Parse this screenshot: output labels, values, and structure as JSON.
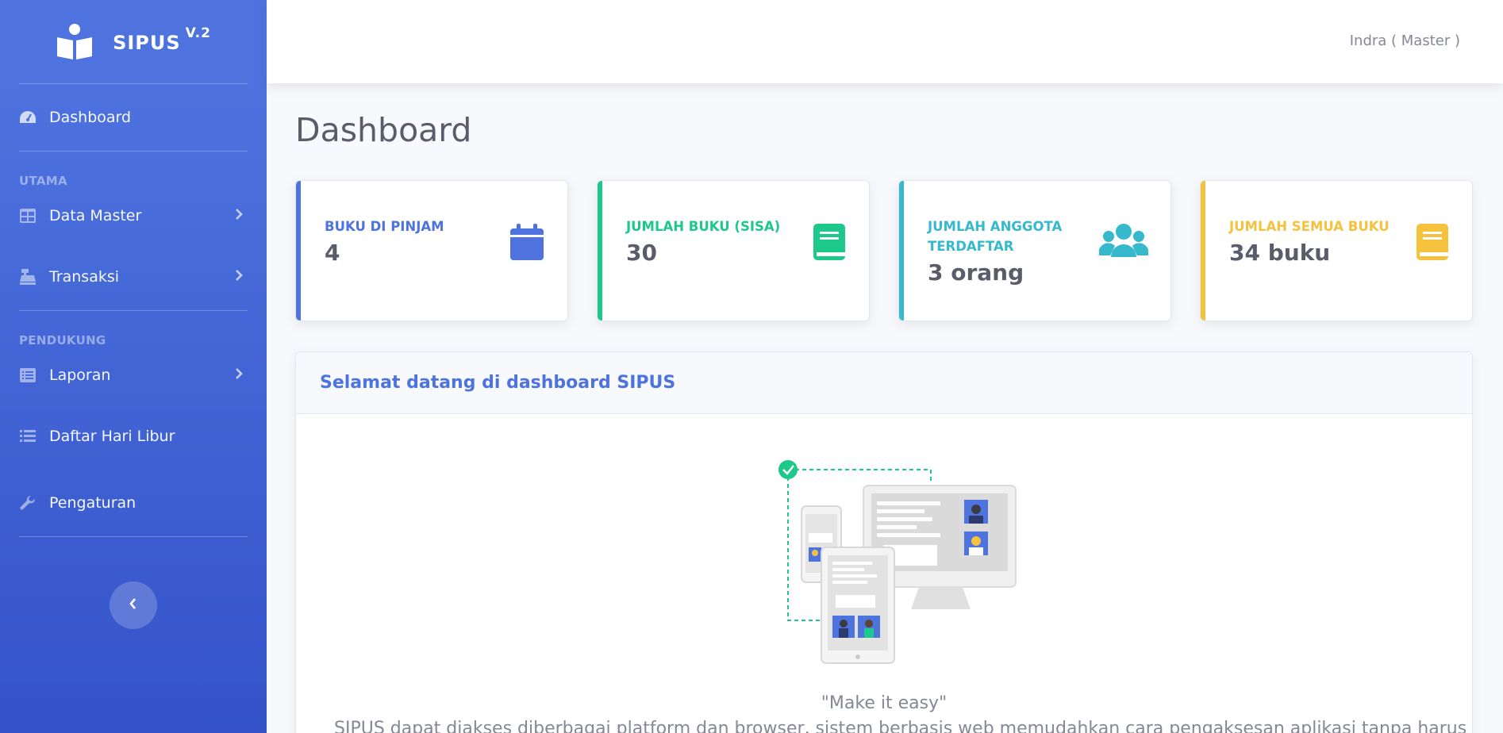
{
  "sidebar": {
    "brand": {
      "name": "SIPUS",
      "version": "V.2"
    },
    "dashboard_label": "Dashboard",
    "heading_utama": "UTAMA",
    "data_master_label": "Data Master",
    "transaksi_label": "Transaksi",
    "heading_pendukung": "PENDUKUNG",
    "laporan_label": "Laporan",
    "hari_libur_label": "Daftar Hari Libur",
    "pengaturan_label": "Pengaturan"
  },
  "topbar": {
    "user": "Indra ( Master )"
  },
  "page": {
    "title": "Dashboard"
  },
  "cards": [
    {
      "label": "BUKU DI PINJAM",
      "value": "4",
      "color": "#4e73df",
      "icon": "calendar-icon"
    },
    {
      "label": "JUMLAH BUKU (SISA)",
      "value": "30",
      "color": "#1cc88a",
      "icon": "book-icon"
    },
    {
      "label": "JUMLAH ANGGOTA TERDAFTAR",
      "value": "3 orang",
      "color": "#36b9cc",
      "icon": "users-icon"
    },
    {
      "label": "JUMLAH SEMUA BUKU",
      "value": "34 buku",
      "color": "#f6c23e",
      "icon": "book-icon"
    }
  ],
  "welcome": {
    "title": "Selamat datang di dashboard SIPUS",
    "quote": "\"Make it easy\"",
    "description": "SIPUS dapat diakses diberbagai platform dan browser, sistem berbasis web memudahkan cara pengaksesan aplikasi tanpa harus"
  }
}
